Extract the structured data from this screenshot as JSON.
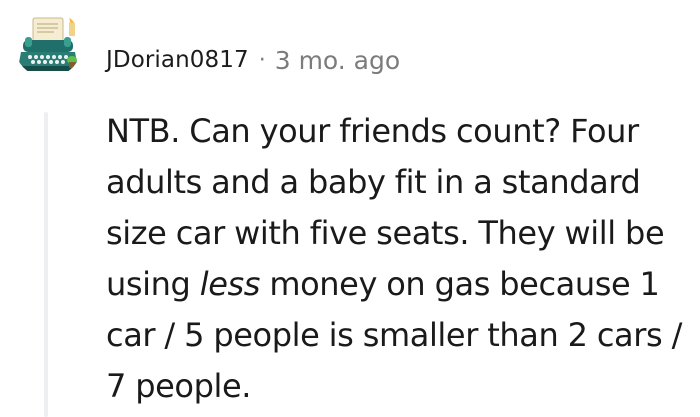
{
  "comment": {
    "username": "JDorian0817",
    "separator": "·",
    "timestamp": "3 mo. ago",
    "avatar_icon": "typewriter-avatar-icon",
    "body": {
      "line1": "NTB. Can your friends count? Four",
      "line2": "adults and a baby fit in a standard",
      "line3": "size car with five seats. They will be",
      "line4_before": "using ",
      "line4_emphasis": "less",
      "line4_after": " money on gas because 1",
      "line5": "car / 5 people is smaller than 2 cars /",
      "line6": "7 people."
    }
  }
}
